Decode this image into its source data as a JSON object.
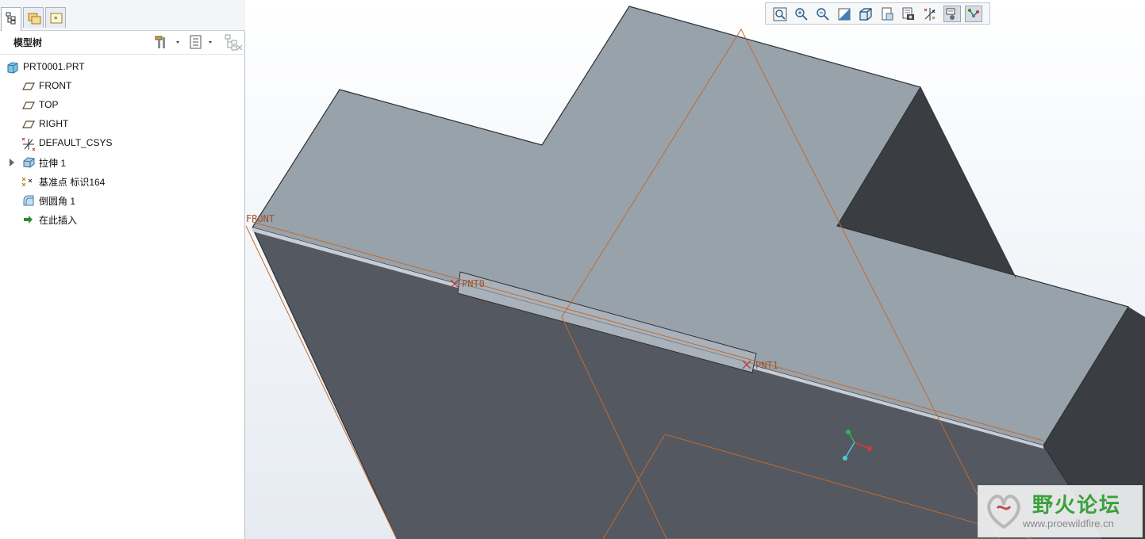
{
  "panel": {
    "tabs": [
      {
        "name": "model-tree-tab-icon"
      },
      {
        "name": "folder-browser-tab-icon"
      },
      {
        "name": "favorites-tab-icon"
      }
    ],
    "title": "模型树",
    "header_icons": [
      "settings-icon",
      "show-icon",
      "filter-icon"
    ]
  },
  "tree": {
    "items": [
      {
        "label": "PRT0001.PRT",
        "icon": "part-icon"
      },
      {
        "label": "FRONT",
        "icon": "datum-plane-icon"
      },
      {
        "label": "TOP",
        "icon": "datum-plane-icon"
      },
      {
        "label": "RIGHT",
        "icon": "datum-plane-icon"
      },
      {
        "label": "DEFAULT_CSYS",
        "icon": "coordinate-system-icon"
      },
      {
        "label": "拉伸 1",
        "icon": "extrude-icon"
      },
      {
        "label": "基准点 标识164",
        "icon": "datum-point-icon"
      },
      {
        "label": "倒圆角 1",
        "icon": "round-icon"
      },
      {
        "label": "在此插入",
        "icon": "insert-here-arrow-icon"
      }
    ]
  },
  "viewport": {
    "labels": {
      "plane_front": "FRONT",
      "point0": "PNT0",
      "point1": "PNT1"
    },
    "colors": {
      "top_face": "#98a2ab",
      "front_face": "#535861",
      "side_face": "#3a3d42",
      "datum": "#c46a2b"
    }
  },
  "toolbar": {
    "buttons": [
      "refit-icon",
      "zoom-in-icon",
      "zoom-out-icon",
      "repaint-icon",
      "display-style-icon",
      "saved-views-icon",
      "view-manager-icon",
      "datum-display-icon",
      "spin-center-icon",
      "annotation-display-icon"
    ]
  },
  "watermark": {
    "title": "野火论坛",
    "url": "www.proewildfire.cn"
  }
}
